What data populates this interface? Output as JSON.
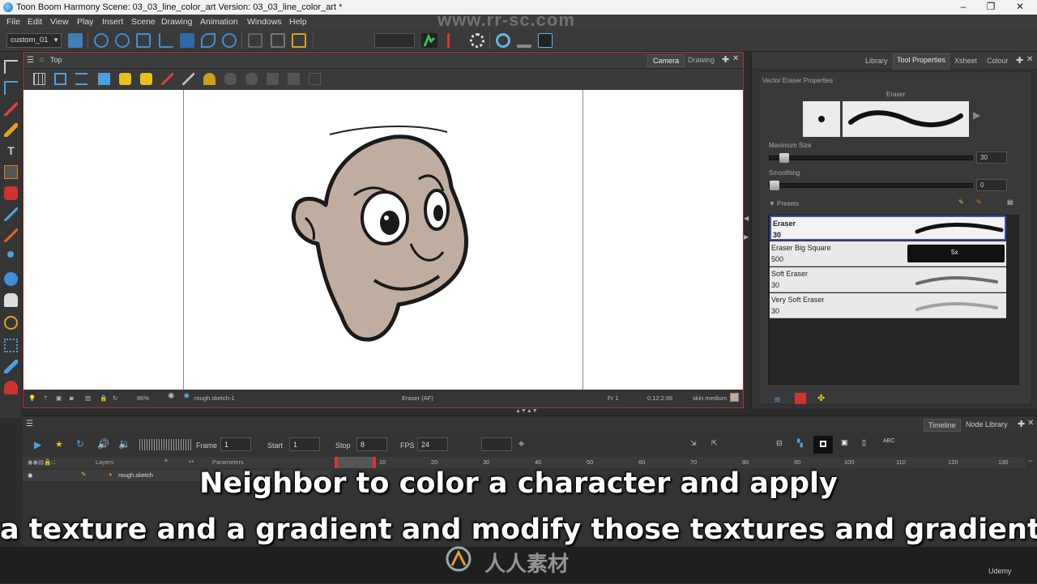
{
  "window": {
    "title": "Toon Boom Harmony Scene: 03_03_line_color_art Version: 03_03_line_color_art *",
    "minimize": "–",
    "maximize": "❐",
    "close": "✕"
  },
  "menubar": [
    "File",
    "Edit",
    "View",
    "Play",
    "Insert",
    "Scene",
    "Drawing",
    "Animation",
    "Windows",
    "Help"
  ],
  "watermark_top": "www.rr-sc.com",
  "toolbar": {
    "workspace": "custom_01"
  },
  "view": {
    "breadcrumb": "Top",
    "tabs": [
      "Camera",
      "Drawing"
    ],
    "status": {
      "zoom": "86%",
      "layer": "rough.sketch-1",
      "tool": "Eraser (AF)",
      "frame": "Fr 1",
      "coords": "0.12:2.96",
      "color": "skin medium"
    }
  },
  "right_panel": {
    "tabs": [
      "Library",
      "Tool Properties",
      "Xsheet",
      "Colour"
    ],
    "active_tab": "Tool Properties",
    "section_title": "Vector Eraser Properties",
    "brush_name": "Eraser",
    "max_size_label": "Maximum Size",
    "max_size_value": "30",
    "max_size_fraction": 0.05,
    "smoothing_label": "Smoothing",
    "smoothing_value": "0",
    "smoothing_fraction": 0,
    "presets_label": "Presets",
    "presets": [
      {
        "name": "Eraser",
        "size": "30",
        "selected": true
      },
      {
        "name": "Eraser Big Square",
        "size": "500",
        "badge": "5x"
      },
      {
        "name": "Soft Eraser",
        "size": "30"
      },
      {
        "name": "Very Soft Eraser",
        "size": "30"
      }
    ]
  },
  "timeline": {
    "tabs": [
      "Timeline",
      "Node Library"
    ],
    "frame_label": "Frame",
    "frame_value": "1",
    "start_label": "Start",
    "start_value": "1",
    "stop_label": "Stop",
    "stop_value": "8",
    "fps_label": "FPS",
    "fps_value": "24",
    "layers_label": "Layers",
    "parameters_label": "Parameters",
    "ruler": [
      "10",
      "20",
      "30",
      "40",
      "50",
      "60",
      "70",
      "80",
      "90",
      "100",
      "110",
      "120",
      "130"
    ],
    "layer_name": "rough.sketch"
  },
  "captions": {
    "line1": "Neighbor to color a character and apply",
    "line2": "a texture and a gradient and modify those textures and gradients."
  },
  "branding": {
    "text": "人人素材",
    "udemy": "Udemy"
  }
}
